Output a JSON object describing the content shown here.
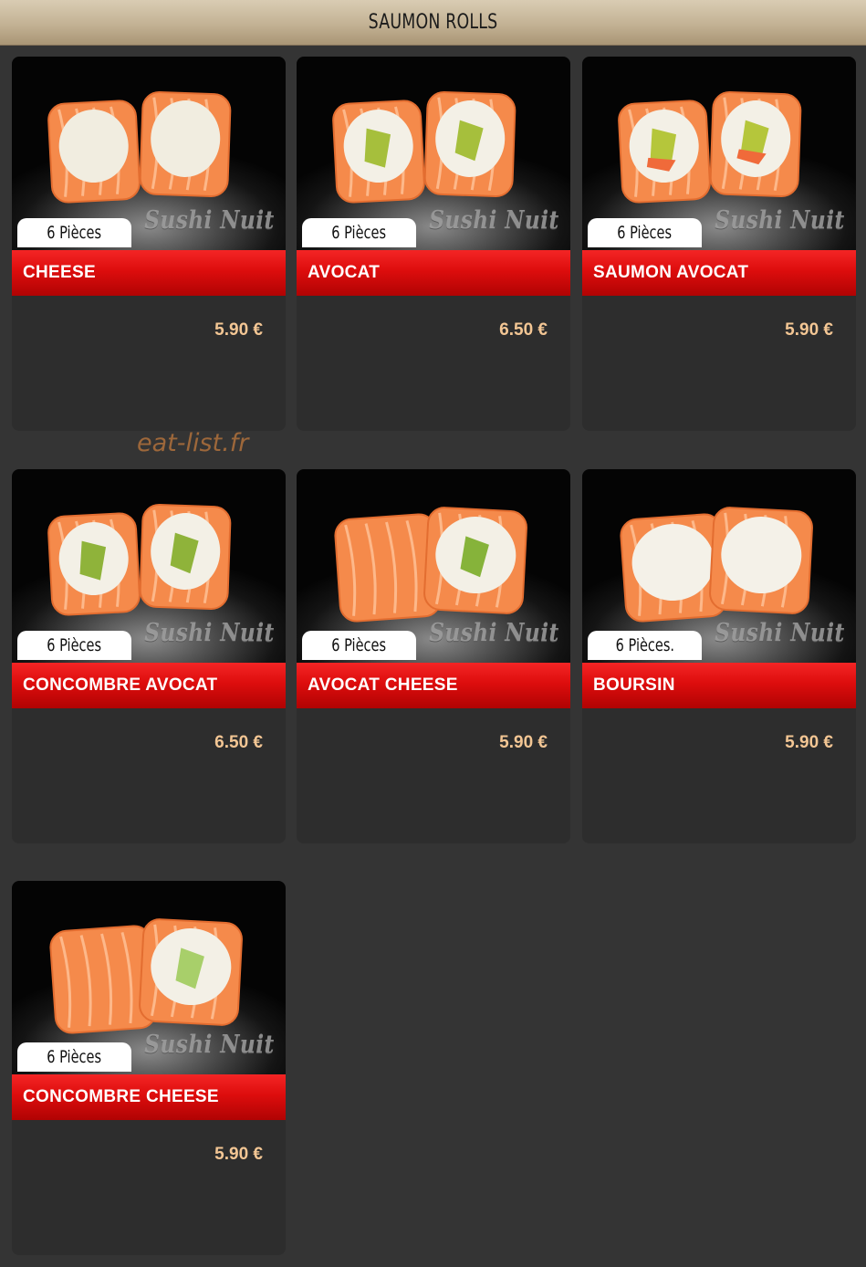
{
  "header": {
    "title": "SAUMON ROLLS"
  },
  "watermark": "eat-list.fr",
  "brand_label": "Sushi Nuit",
  "products": [
    {
      "pieces": "6 Pièces",
      "name": "CHEESE",
      "price": "5.90 €",
      "filling": "cheese"
    },
    {
      "pieces": "6 Pièces",
      "name": "AVOCAT",
      "price": "6.50 €",
      "filling": "avocado"
    },
    {
      "pieces": "6 Pièces",
      "name": "SAUMON AVOCAT",
      "price": "5.90 €",
      "filling": "salmon-avocado"
    },
    {
      "pieces": "6 Pièces",
      "name": "CONCOMBRE AVOCAT",
      "price": "6.50 €",
      "filling": "cucumber-avocado"
    },
    {
      "pieces": "6 Pièces",
      "name": "AVOCAT CHEESE",
      "price": "5.90 €",
      "filling": "avocado-cheese"
    },
    {
      "pieces": "6 Pièces.",
      "name": "BOURSIN",
      "price": "5.90 €",
      "filling": "boursin"
    },
    {
      "pieces": "6 Pièces",
      "name": "CONCOMBRE CHEESE",
      "price": "5.90 €",
      "filling": "cucumber-cheese"
    }
  ],
  "colors": {
    "header_top": "#d9ccb3",
    "header_bottom": "#a99575",
    "name_bar": "#dd0d0d",
    "price": "#f3c694",
    "card": "#2d2d2d",
    "page": "#343434",
    "watermark": "#b0713c"
  }
}
